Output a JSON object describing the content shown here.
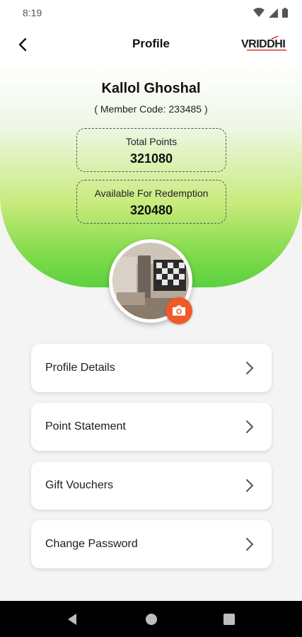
{
  "status_bar": {
    "time": "8:19",
    "icons": [
      "wifi-icon",
      "signal-icon",
      "battery-icon"
    ]
  },
  "header": {
    "title": "Profile",
    "logo_text": "VRIDDHI"
  },
  "profile": {
    "name": "Kallol Ghoshal",
    "member_code": "( Member Code: 233485 )",
    "total_points_label": "Total Points",
    "total_points_value": "321080",
    "available_label": "Available For Redemption",
    "available_value": "320480"
  },
  "menu": {
    "items": [
      {
        "label": "Profile Details"
      },
      {
        "label": "Point Statement"
      },
      {
        "label": "Gift Vouchers"
      },
      {
        "label": "Change Password"
      }
    ]
  },
  "colors": {
    "accent_green": "#5cd13f",
    "camera_orange": "#ee5a2a",
    "logo_red": "#e3342f"
  }
}
